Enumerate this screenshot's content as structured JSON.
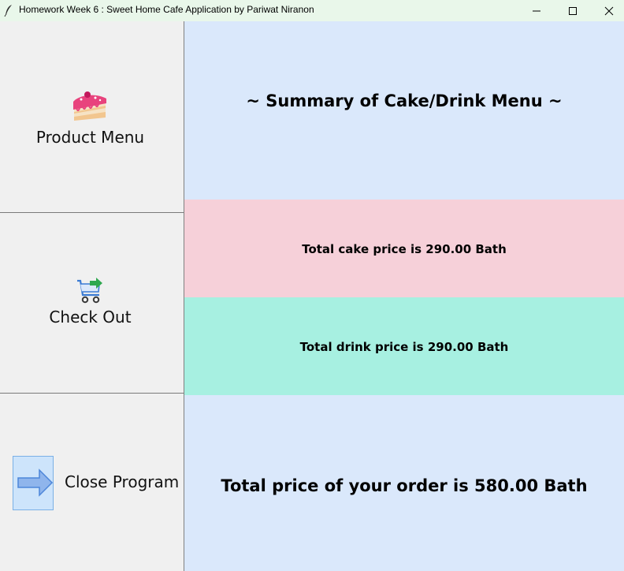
{
  "window": {
    "title": "Homework Week 6 : Sweet Home Cafe Application by Pariwat Niranon",
    "app_icon": "feather-icon",
    "controls": {
      "minimize_icon": "minimize-icon",
      "maximize_icon": "maximize-icon",
      "close_icon": "close-icon"
    }
  },
  "sidebar": {
    "product_menu": {
      "label": "Product Menu",
      "icon": "cake-icon"
    },
    "check_out": {
      "label": "Check Out",
      "icon": "cart-icon"
    },
    "close_program": {
      "label": "Close Program",
      "icon": "arrow-right-icon"
    }
  },
  "summary": {
    "heading": "~ Summary of Cake/Drink Menu ~",
    "cake_total": "Total cake price is 290.00 Bath",
    "drink_total": "Total drink price is 290.00 Bath",
    "order_total": "Total price of your order is 580.00 Bath"
  },
  "colors": {
    "titlebar": "#e9f7ea",
    "sidebar": "#f0f0f0",
    "summary_bg": "#dae8fb",
    "cake_bg": "#f6d0d9",
    "drink_bg": "#a7f0e1",
    "total_bg": "#dae8fb"
  }
}
